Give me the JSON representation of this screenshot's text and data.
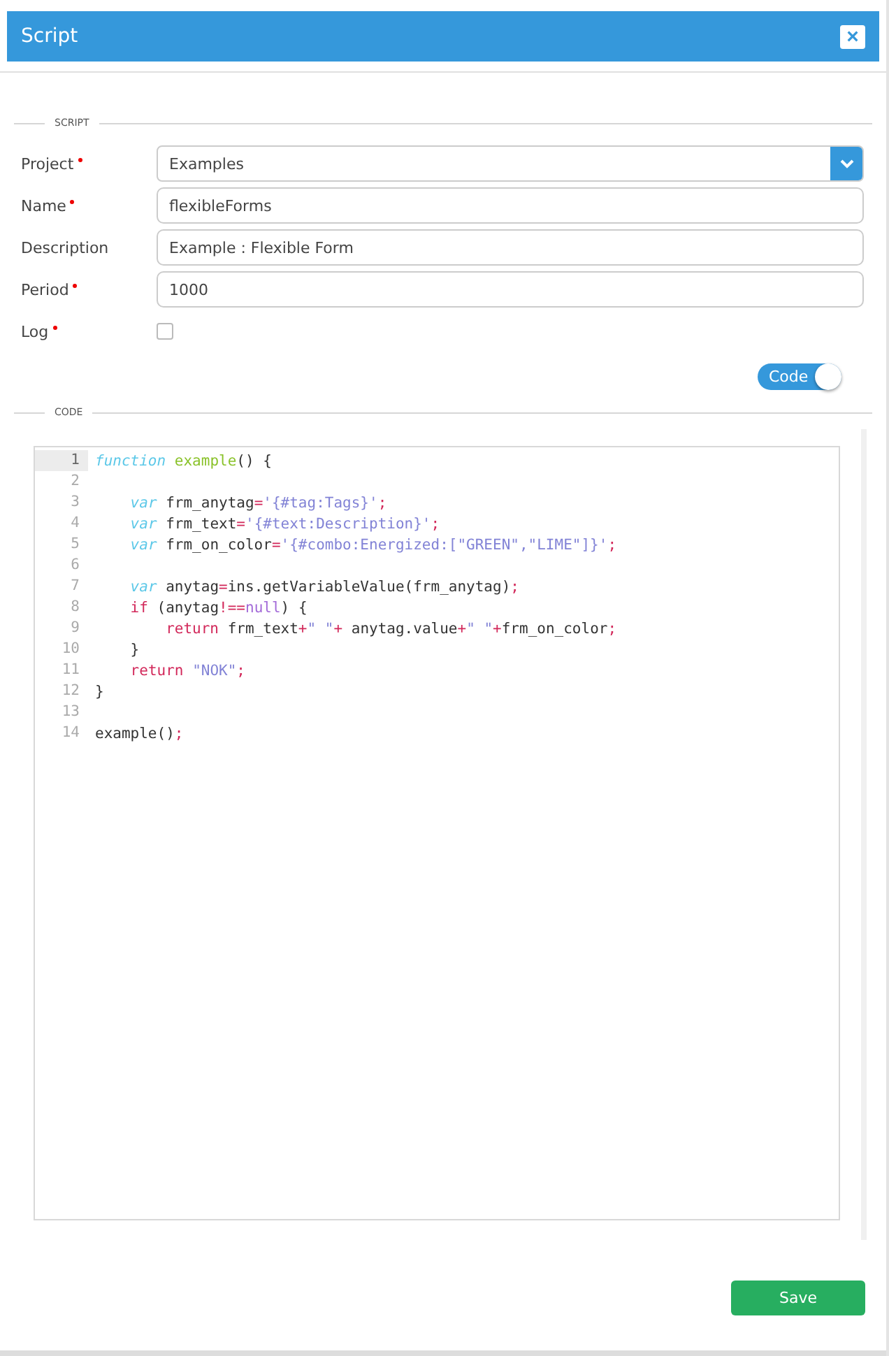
{
  "window": {
    "title": "Script",
    "close": "×"
  },
  "script_section": {
    "legend": "SCRIPT",
    "fields": [
      {
        "kind": "select",
        "label": "Project",
        "required": true,
        "value": "Examples"
      },
      {
        "kind": "text",
        "label": "Name",
        "required": true,
        "value": "flexibleForms"
      },
      {
        "kind": "text",
        "label": "Description",
        "required": false,
        "value": "Example : Flexible Form"
      },
      {
        "kind": "text",
        "label": "Period",
        "required": true,
        "value": "1000"
      },
      {
        "kind": "checkbox",
        "label": "Log",
        "required": true,
        "checked": false
      }
    ]
  },
  "code_toggle": {
    "label": "Code",
    "on": true
  },
  "code_section": {
    "legend": "CODE",
    "lines": [
      {
        "number": "1",
        "active": true,
        "text": "function example() {"
      },
      {
        "number": "2",
        "active": false
      },
      {
        "number": "3",
        "active": false,
        "text": "    var frm_anytag='{#tag:Tags}';"
      },
      {
        "number": "4",
        "active": false,
        "text": "    var frm_text='{#text:Description}';"
      },
      {
        "number": "5",
        "active": false,
        "text": "    var frm_on_color='{#combo:Energized:[\"GREEN\",\"LIME\"]}';"
      },
      {
        "number": "6",
        "active": false
      },
      {
        "number": "7",
        "active": false,
        "text": "    var anytag=ins.getVariableValue(frm_anytag);"
      },
      {
        "number": "8",
        "active": false,
        "text": "    if (anytag!==null) {"
      },
      {
        "number": "9",
        "active": false,
        "text": "        return frm_text+\" \"+ anytag.value+\" \"+frm_on_color;"
      },
      {
        "number": "10",
        "active": false,
        "text": "    }"
      },
      {
        "number": "11",
        "active": false,
        "text": "    return \"NOK\";"
      },
      {
        "number": "12",
        "active": false,
        "text": "}"
      },
      {
        "number": "13",
        "active": false
      },
      {
        "number": "14",
        "active": false,
        "text": "example();"
      }
    ]
  },
  "buttons": [
    {
      "label": "Save"
    }
  ]
}
